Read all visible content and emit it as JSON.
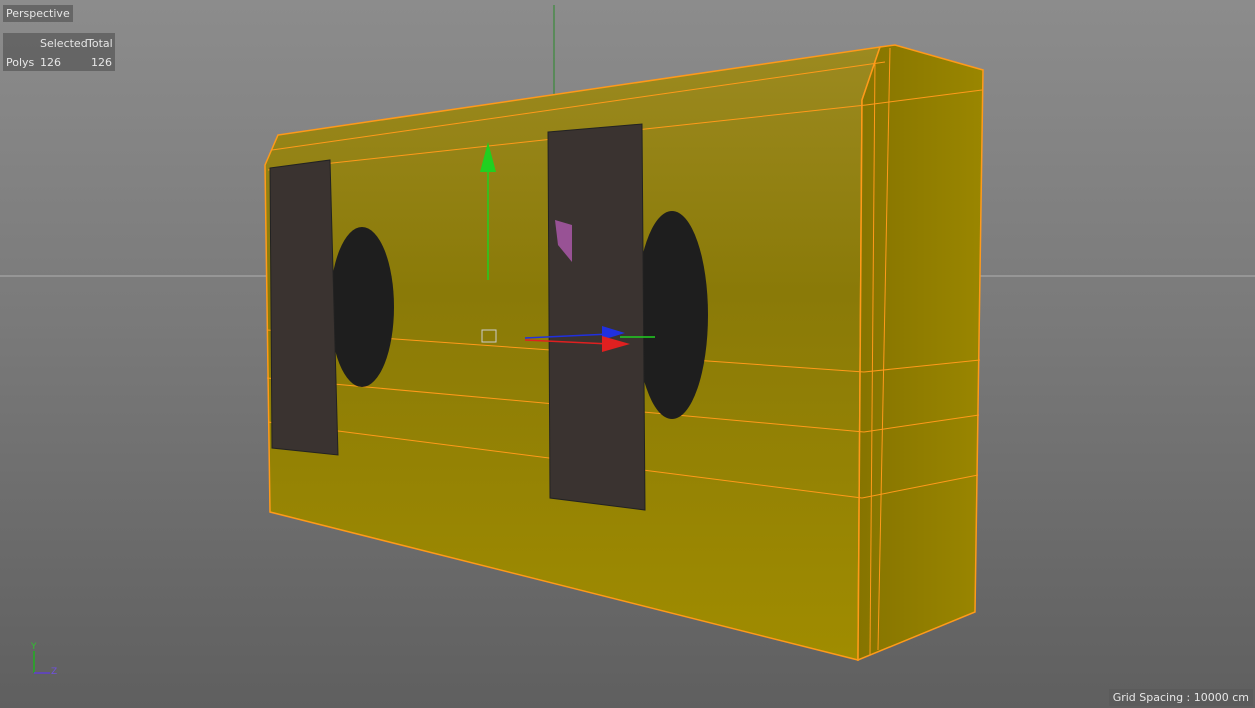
{
  "viewport": {
    "camera_label": "Perspective",
    "stats": {
      "col_selected": "Selected",
      "col_total": "Total",
      "row_label": "Polys",
      "selected": "126",
      "total": "126"
    },
    "grid_spacing": "Grid Spacing : 10000 cm",
    "axis_labels": {
      "y": "Y",
      "z": "Z"
    },
    "colors": {
      "selection": "#ff9a1a",
      "object": "#8c7a00",
      "x_axis": "#e02020",
      "y_axis": "#20d020",
      "z_axis": "#2030e0"
    }
  }
}
